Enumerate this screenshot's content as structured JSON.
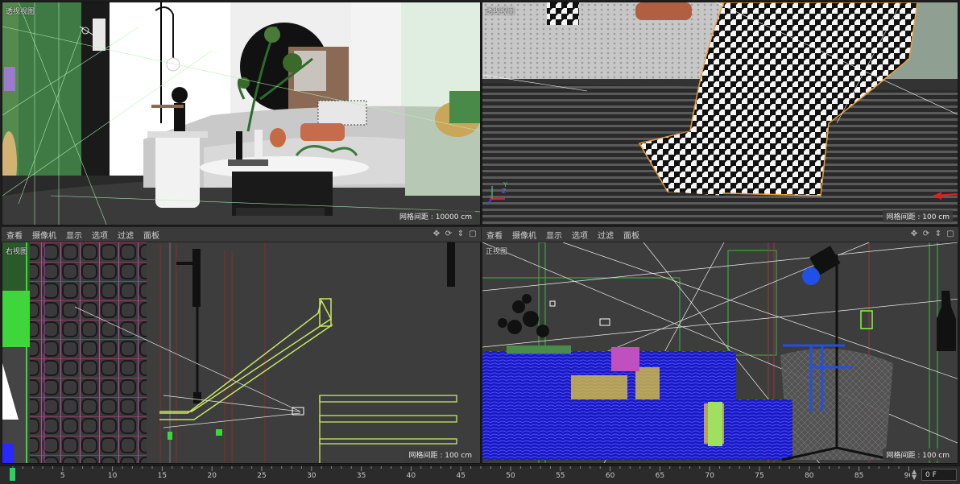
{
  "viewports": {
    "top_left": {
      "label": "透视视图",
      "grid": "网格间距 : 10000 cm"
    },
    "top_right": {
      "label": "透视视图",
      "grid": "网格间距 : 100 cm"
    },
    "bottom_left": {
      "label": "右视图",
      "grid": "网格间距 : 100 cm"
    },
    "bottom_right": {
      "label": "正视图",
      "grid": "网格间距 : 100 cm"
    }
  },
  "viewport_menu": [
    "查看",
    "摄像机",
    "显示",
    "选项",
    "过滤",
    "面板"
  ],
  "axis_labels": {
    "x": "X",
    "y": "Y",
    "z": "Z"
  },
  "timeline": {
    "ticks": [
      "0",
      "5",
      "10",
      "15",
      "20",
      "25",
      "30",
      "35",
      "40",
      "45",
      "50",
      "55",
      "60",
      "65",
      "70",
      "75",
      "80",
      "85",
      "90"
    ],
    "current_frame": "0 F"
  },
  "icons": [
    "move-icon",
    "rotate-icon",
    "zoom-icon",
    "maximize-icon",
    "camera-icon",
    "playhead-icon"
  ],
  "colors": {
    "viewport_bg": "#333333",
    "wire_green": "#7fff3f",
    "wire_pink": "#e040c0",
    "wire_blue": "#2020ff",
    "selection_orange": "#e8a040"
  }
}
